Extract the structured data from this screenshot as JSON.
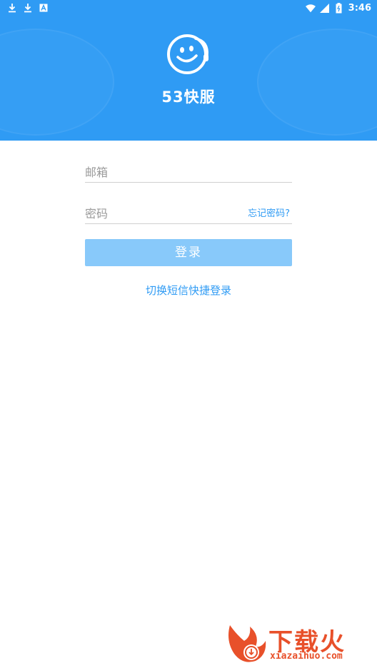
{
  "status_bar": {
    "time": "3:46",
    "icons_left": [
      "download-icon",
      "download-icon",
      "a-notification-icon"
    ],
    "icons_right": [
      "wifi-icon",
      "signal-icon",
      "battery-icon"
    ]
  },
  "header": {
    "logo_icon": "smiley-headset-icon",
    "app_title": "53快服",
    "background_color": "#2f9bf4"
  },
  "login_form": {
    "email_placeholder": "邮箱",
    "password_placeholder": "密码",
    "forgot_password": "忘记密码?",
    "login_button": "登录",
    "switch_sms_login": "切换短信快捷登录"
  },
  "watermark": {
    "text": "下载火",
    "url": "xiazaihuo.com"
  },
  "colors": {
    "accent": "#2f9bf4",
    "button_disabled": "#88c9fa",
    "placeholder": "#9a9a9a",
    "watermark": "#e8502a"
  }
}
